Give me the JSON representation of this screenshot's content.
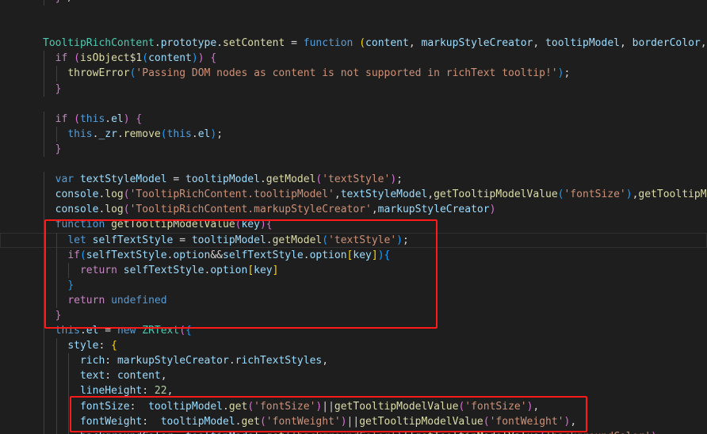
{
  "lines": [
    [
      {
        "t": "  ",
        "c": "pun"
      },
      {
        "t": "}",
        "c": "br2"
      },
      {
        "t": "*/",
        "c": "pun"
      }
    ],
    [],
    [],
    [
      {
        "t": "TooltipRichContent",
        "c": "cls"
      },
      {
        "t": ".",
        "c": "pun"
      },
      {
        "t": "prototype",
        "c": "var"
      },
      {
        "t": ".",
        "c": "pun"
      },
      {
        "t": "setContent",
        "c": "fn"
      },
      {
        "t": " = ",
        "c": "pun"
      },
      {
        "t": "function",
        "c": "kw"
      },
      {
        "t": " ",
        "c": "pun"
      },
      {
        "t": "(",
        "c": "br1"
      },
      {
        "t": "content",
        "c": "var"
      },
      {
        "t": ", ",
        "c": "pun"
      },
      {
        "t": "markupStyleCreator",
        "c": "var"
      },
      {
        "t": ", ",
        "c": "pun"
      },
      {
        "t": "tooltipModel",
        "c": "var"
      },
      {
        "t": ", ",
        "c": "pun"
      },
      {
        "t": "borderColor",
        "c": "var"
      },
      {
        "t": ", ",
        "c": "pun"
      },
      {
        "t": "a",
        "c": "var"
      }
    ],
    [
      {
        "t": "  ",
        "c": "pun"
      },
      {
        "t": "if",
        "c": "ctl"
      },
      {
        "t": " ",
        "c": "pun"
      },
      {
        "t": "(",
        "c": "br2"
      },
      {
        "t": "isObject$1",
        "c": "fn"
      },
      {
        "t": "(",
        "c": "br3"
      },
      {
        "t": "content",
        "c": "var"
      },
      {
        "t": ")",
        "c": "br3"
      },
      {
        "t": ")",
        "c": "br2"
      },
      {
        "t": " ",
        "c": "pun"
      },
      {
        "t": "{",
        "c": "br2"
      }
    ],
    [
      {
        "t": "    ",
        "c": "pun"
      },
      {
        "t": "throwError",
        "c": "fn"
      },
      {
        "t": "(",
        "c": "br3"
      },
      {
        "t": "'Passing DOM nodes as content is not supported in richText tooltip!'",
        "c": "str"
      },
      {
        "t": ")",
        "c": "br3"
      },
      {
        "t": ";",
        "c": "pun"
      }
    ],
    [
      {
        "t": "  ",
        "c": "pun"
      },
      {
        "t": "}",
        "c": "br2"
      }
    ],
    [],
    [
      {
        "t": "  ",
        "c": "pun"
      },
      {
        "t": "if",
        "c": "ctl"
      },
      {
        "t": " ",
        "c": "pun"
      },
      {
        "t": "(",
        "c": "br2"
      },
      {
        "t": "this",
        "c": "kw"
      },
      {
        "t": ".",
        "c": "pun"
      },
      {
        "t": "el",
        "c": "var"
      },
      {
        "t": ")",
        "c": "br2"
      },
      {
        "t": " ",
        "c": "pun"
      },
      {
        "t": "{",
        "c": "br2"
      }
    ],
    [
      {
        "t": "    ",
        "c": "pun"
      },
      {
        "t": "this",
        "c": "kw"
      },
      {
        "t": ".",
        "c": "pun"
      },
      {
        "t": "_zr",
        "c": "var"
      },
      {
        "t": ".",
        "c": "pun"
      },
      {
        "t": "remove",
        "c": "fn"
      },
      {
        "t": "(",
        "c": "br3"
      },
      {
        "t": "this",
        "c": "kw"
      },
      {
        "t": ".",
        "c": "pun"
      },
      {
        "t": "el",
        "c": "var"
      },
      {
        "t": ")",
        "c": "br3"
      },
      {
        "t": ";",
        "c": "pun"
      }
    ],
    [
      {
        "t": "  ",
        "c": "pun"
      },
      {
        "t": "}",
        "c": "br2"
      }
    ],
    [],
    [
      {
        "t": "  ",
        "c": "pun"
      },
      {
        "t": "var",
        "c": "kw"
      },
      {
        "t": " ",
        "c": "pun"
      },
      {
        "t": "textStyleModel",
        "c": "var"
      },
      {
        "t": " = ",
        "c": "pun"
      },
      {
        "t": "tooltipModel",
        "c": "var"
      },
      {
        "t": ".",
        "c": "pun"
      },
      {
        "t": "getModel",
        "c": "fn"
      },
      {
        "t": "(",
        "c": "br2"
      },
      {
        "t": "'textStyle'",
        "c": "str"
      },
      {
        "t": ")",
        "c": "br2"
      },
      {
        "t": ";",
        "c": "pun"
      }
    ],
    [
      {
        "t": "  ",
        "c": "pun"
      },
      {
        "t": "console",
        "c": "var"
      },
      {
        "t": ".",
        "c": "pun"
      },
      {
        "t": "log",
        "c": "fn"
      },
      {
        "t": "(",
        "c": "br2"
      },
      {
        "t": "'TooltipRichContent.tooltipModel'",
        "c": "str"
      },
      {
        "t": ",",
        "c": "pun"
      },
      {
        "t": "textStyleModel",
        "c": "var"
      },
      {
        "t": ",",
        "c": "pun"
      },
      {
        "t": "getTooltipModelValue",
        "c": "fn"
      },
      {
        "t": "(",
        "c": "br3"
      },
      {
        "t": "'fontSize'",
        "c": "str"
      },
      {
        "t": ")",
        "c": "br3"
      },
      {
        "t": ",",
        "c": "pun"
      },
      {
        "t": "getTooltipMod",
        "c": "fn"
      }
    ],
    [
      {
        "t": "  ",
        "c": "pun"
      },
      {
        "t": "console",
        "c": "var"
      },
      {
        "t": ".",
        "c": "pun"
      },
      {
        "t": "log",
        "c": "fn"
      },
      {
        "t": "(",
        "c": "br2"
      },
      {
        "t": "'TooltipRichContent.markupStyleCreator'",
        "c": "str"
      },
      {
        "t": ",",
        "c": "pun"
      },
      {
        "t": "markupStyleCreator",
        "c": "var"
      },
      {
        "t": ")",
        "c": "br2"
      }
    ],
    [
      {
        "t": "  ",
        "c": "pun"
      },
      {
        "t": "function",
        "c": "kw"
      },
      {
        "t": " ",
        "c": "pun"
      },
      {
        "t": "getTooltipModelValue",
        "c": "fn"
      },
      {
        "t": "(",
        "c": "br2"
      },
      {
        "t": "key",
        "c": "var"
      },
      {
        "t": ")",
        "c": "br2"
      },
      {
        "t": "{",
        "c": "br2"
      }
    ],
    [
      {
        "t": "    ",
        "c": "pun"
      },
      {
        "t": "let",
        "c": "kw"
      },
      {
        "t": " ",
        "c": "pun"
      },
      {
        "t": "selfTextStyle",
        "c": "var"
      },
      {
        "t": " = ",
        "c": "pun"
      },
      {
        "t": "tooltipModel",
        "c": "var"
      },
      {
        "t": ".",
        "c": "pun"
      },
      {
        "t": "getModel",
        "c": "fn"
      },
      {
        "t": "(",
        "c": "br3"
      },
      {
        "t": "'textStyle'",
        "c": "str"
      },
      {
        "t": ")",
        "c": "br3"
      },
      {
        "t": ";",
        "c": "pun"
      }
    ],
    [
      {
        "t": "    ",
        "c": "pun"
      },
      {
        "t": "if",
        "c": "ctl"
      },
      {
        "t": "(",
        "c": "br3"
      },
      {
        "t": "selfTextStyle",
        "c": "var"
      },
      {
        "t": ".",
        "c": "pun"
      },
      {
        "t": "option",
        "c": "var"
      },
      {
        "t": "&&",
        "c": "pun"
      },
      {
        "t": "selfTextStyle",
        "c": "var"
      },
      {
        "t": ".",
        "c": "pun"
      },
      {
        "t": "option",
        "c": "var"
      },
      {
        "t": "[",
        "c": "br1"
      },
      {
        "t": "key",
        "c": "var"
      },
      {
        "t": "]",
        "c": "br1"
      },
      {
        "t": ")",
        "c": "br3"
      },
      {
        "t": "{",
        "c": "br3"
      }
    ],
    [
      {
        "t": "      ",
        "c": "pun"
      },
      {
        "t": "return",
        "c": "ctl"
      },
      {
        "t": " ",
        "c": "pun"
      },
      {
        "t": "selfTextStyle",
        "c": "var"
      },
      {
        "t": ".",
        "c": "pun"
      },
      {
        "t": "option",
        "c": "var"
      },
      {
        "t": "[",
        "c": "br1"
      },
      {
        "t": "key",
        "c": "var"
      },
      {
        "t": "]",
        "c": "br1"
      }
    ],
    [
      {
        "t": "    ",
        "c": "pun"
      },
      {
        "t": "}",
        "c": "br3"
      }
    ],
    [
      {
        "t": "    ",
        "c": "pun"
      },
      {
        "t": "return",
        "c": "ctl"
      },
      {
        "t": " ",
        "c": "pun"
      },
      {
        "t": "undefined",
        "c": "kw"
      }
    ],
    [
      {
        "t": "  ",
        "c": "pun"
      },
      {
        "t": "}",
        "c": "br2"
      }
    ],
    [
      {
        "t": "  ",
        "c": "pun"
      },
      {
        "t": "this",
        "c": "kw"
      },
      {
        "t": ".",
        "c": "pun"
      },
      {
        "t": "el",
        "c": "var"
      },
      {
        "t": " = ",
        "c": "pun"
      },
      {
        "t": "new",
        "c": "kw"
      },
      {
        "t": " ",
        "c": "pun"
      },
      {
        "t": "ZRText",
        "c": "cls"
      },
      {
        "t": "(",
        "c": "br2"
      },
      {
        "t": "{",
        "c": "br3"
      }
    ],
    [
      {
        "t": "    ",
        "c": "pun"
      },
      {
        "t": "style",
        "c": "var"
      },
      {
        "t": ": ",
        "c": "pun"
      },
      {
        "t": "{",
        "c": "br1"
      }
    ],
    [
      {
        "t": "      ",
        "c": "pun"
      },
      {
        "t": "rich",
        "c": "var"
      },
      {
        "t": ": ",
        "c": "pun"
      },
      {
        "t": "markupStyleCreator",
        "c": "var"
      },
      {
        "t": ".",
        "c": "pun"
      },
      {
        "t": "richTextStyles",
        "c": "var"
      },
      {
        "t": ",",
        "c": "pun"
      }
    ],
    [
      {
        "t": "      ",
        "c": "pun"
      },
      {
        "t": "text",
        "c": "var"
      },
      {
        "t": ": ",
        "c": "pun"
      },
      {
        "t": "content",
        "c": "var"
      },
      {
        "t": ",",
        "c": "pun"
      }
    ],
    [
      {
        "t": "      ",
        "c": "pun"
      },
      {
        "t": "lineHeight",
        "c": "var"
      },
      {
        "t": ": ",
        "c": "pun"
      },
      {
        "t": "22",
        "c": "num"
      },
      {
        "t": ",",
        "c": "pun"
      }
    ],
    [
      {
        "t": "      ",
        "c": "pun"
      },
      {
        "t": "fontSize",
        "c": "var"
      },
      {
        "t": ":  ",
        "c": "pun"
      },
      {
        "t": "tooltipModel",
        "c": "var"
      },
      {
        "t": ".",
        "c": "pun"
      },
      {
        "t": "get",
        "c": "fn"
      },
      {
        "t": "(",
        "c": "br2"
      },
      {
        "t": "'fontSize'",
        "c": "str"
      },
      {
        "t": ")",
        "c": "br2"
      },
      {
        "t": "||",
        "c": "pun"
      },
      {
        "t": "getTooltipModelValue",
        "c": "fn"
      },
      {
        "t": "(",
        "c": "br2"
      },
      {
        "t": "'fontSize'",
        "c": "str"
      },
      {
        "t": ")",
        "c": "br2"
      },
      {
        "t": ",",
        "c": "pun"
      }
    ],
    [
      {
        "t": "      ",
        "c": "pun"
      },
      {
        "t": "fontWeight",
        "c": "var"
      },
      {
        "t": ":  ",
        "c": "pun"
      },
      {
        "t": "tooltipModel",
        "c": "var"
      },
      {
        "t": ".",
        "c": "pun"
      },
      {
        "t": "get",
        "c": "fn"
      },
      {
        "t": "(",
        "c": "br2"
      },
      {
        "t": "'fontWeight'",
        "c": "str"
      },
      {
        "t": ")",
        "c": "br2"
      },
      {
        "t": "||",
        "c": "pun"
      },
      {
        "t": "getTooltipModelValue",
        "c": "fn"
      },
      {
        "t": "(",
        "c": "br2"
      },
      {
        "t": "'fontWeight'",
        "c": "str"
      },
      {
        "t": ")",
        "c": "br2"
      },
      {
        "t": ",",
        "c": "pun"
      }
    ],
    [
      {
        "t": "      ",
        "c": "pun"
      },
      {
        "t": "backgroundColor",
        "c": "var"
      },
      {
        "t": ": ",
        "c": "pun"
      },
      {
        "t": "tooltipModel",
        "c": "var"
      },
      {
        "t": ".",
        "c": "pun"
      },
      {
        "t": "get",
        "c": "fn"
      },
      {
        "t": "(",
        "c": "br2"
      },
      {
        "t": "'backgroundColor'",
        "c": "str"
      },
      {
        "t": ")",
        "c": "br2"
      },
      {
        "t": "||",
        "c": "pun"
      },
      {
        "t": "getTooltipModelValue",
        "c": "fn"
      },
      {
        "t": "(",
        "c": "br2"
      },
      {
        "t": "'backgroundColor'",
        "c": "str"
      },
      {
        "t": ")",
        "c": "br2"
      }
    ]
  ]
}
